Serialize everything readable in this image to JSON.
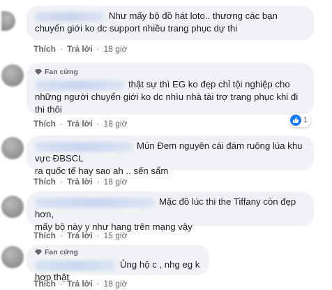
{
  "comments": [
    {
      "fan": "",
      "text": "Như mấy bộ đồ hát loto.. thương các bạn chuyển giới ko dc support nhiều trang phục dự thi",
      "line1": "Như mấy bộ đồ hát loto.. thương các bạn",
      "line2": "chuyển giới ko dc support nhiều trang phục dự thi",
      "like": "Thích",
      "reply": "Trả lời",
      "time": "18 giờ"
    },
    {
      "fan": "Fan cứng",
      "line1": "thật sự thì EG ko đẹp chỉ tội nghiệp cho",
      "line2": "những người chuyển giới ko dc nhìu nhà tài trợ trang phục khi đi",
      "line3": "thi thôi",
      "like": "Thích",
      "reply": "Trả lời",
      "time": "18 giờ",
      "reaction_count": "1"
    },
    {
      "line1": "Mún Đem nguyên cái đám ruộng lúa khu vực ĐBSCL",
      "line2": "ra quốc tế hay sao ah .. sến sẩm",
      "like": "Thích",
      "reply": "Trả lời",
      "time": "18 giờ"
    },
    {
      "line1": "Mặc đồ lúc thi the Tiffany còn đẹp hơn,",
      "line2": "mấy bộ này y như hang trên mạng vậy",
      "like": "Thích",
      "reply": "Trả lời",
      "time": "15 giờ"
    },
    {
      "fan": "Fan cứng",
      "line1": "Ủng hộ c , nhg eg k hợp thật",
      "like": "Thích",
      "reply": "Trả lời",
      "time": "18 giờ"
    }
  ],
  "colors": {
    "bubble": "#f0f2f5",
    "meta": "#65676b",
    "like_blue": "#1877f2"
  },
  "icons": {
    "fan_badge": "diamond-badge-icon",
    "reaction": "thumbs-up-icon"
  }
}
